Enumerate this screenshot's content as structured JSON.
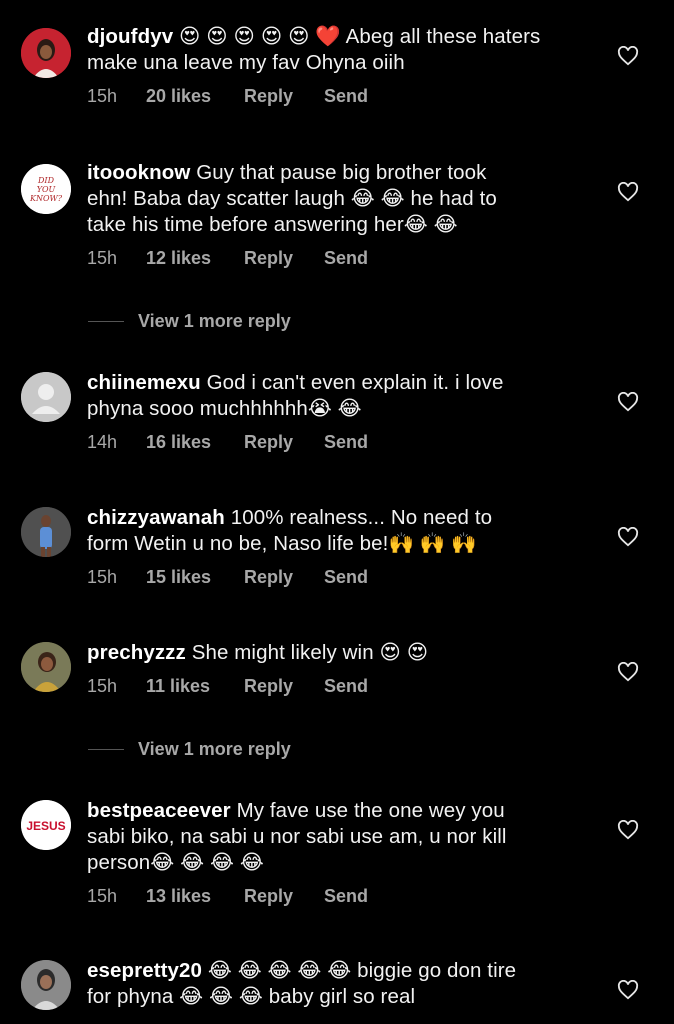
{
  "comments": [
    {
      "username": "djoufdyv",
      "text": "Abeg all these haters make una leave my fav Ohyna oiih",
      "emojis_lead": "😍 😍 😍 😍 😍 ❤️",
      "time": "15h",
      "likes": "20 likes",
      "reply": "Reply",
      "send": "Send"
    },
    {
      "username": "itoooknow",
      "line1": "Guy that pause big brother took",
      "line2": "ehn! Baba day scatter laugh 😂 😂  he had to",
      "line3": "take his time before answering her😂 😂",
      "avatar_text": "DID YOU KNOW?",
      "time": "15h",
      "likes": "12 likes",
      "reply": "Reply",
      "send": "Send",
      "view_more": "View 1 more reply"
    },
    {
      "username": "chiinemexu",
      "line1": "God i can't even explain it. i love",
      "line2": "phyna sooo muchhhhhh😭 😂",
      "time": "14h",
      "likes": "16 likes",
      "reply": "Reply",
      "send": "Send"
    },
    {
      "username": "chizzyawanah",
      "line1": "100% realness... No need to",
      "line2": "form Wetin u no be, Naso life be!🙌 🙌 🙌",
      "time": "15h",
      "likes": "15 likes",
      "reply": "Reply",
      "send": "Send"
    },
    {
      "username": "prechyzzz",
      "line1": "She might likely win 😍 😍",
      "time": "15h",
      "likes": "11 likes",
      "reply": "Reply",
      "send": "Send",
      "view_more": "View 1 more reply"
    },
    {
      "username": "bestpeaceever",
      "line1": "My fave use the one wey you",
      "line2": "sabi biko, na sabi u nor sabi use am, u nor kill",
      "line3": "person😂 😂 😂 😂",
      "avatar_text": "JESUS",
      "time": "15h",
      "likes": "13 likes",
      "reply": "Reply",
      "send": "Send"
    },
    {
      "username": "esepretty20",
      "line1": "😂 😂 😂 😂 😂  biggie go don tire",
      "line2": "for phyna 😂 😂 😂  baby girl so real"
    }
  ],
  "colors": {
    "background": "#000000",
    "text": "#f2f2f2",
    "meta": "#a8a8a8",
    "avatar_gray": "#c8c8c8"
  },
  "icons": {
    "like": "heart-outline-icon"
  }
}
